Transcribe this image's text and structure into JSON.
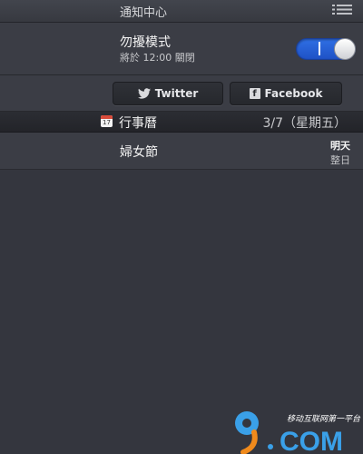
{
  "header": {
    "title": "通知中心",
    "list_icon": "list-icon"
  },
  "do_not_disturb": {
    "title": "勿擾模式",
    "subtitle": "將於 12:00 關閉",
    "enabled": true,
    "accent": "#2f6fe4"
  },
  "share": {
    "twitter_label": "Twitter",
    "twitter_icon": "twitter-bird-icon",
    "facebook_label": "Facebook",
    "facebook_icon": "facebook-f-icon"
  },
  "calendar": {
    "icon": "calendar-icon",
    "icon_number": "17",
    "title": "行事曆",
    "date": "3/7（星期五）",
    "events": [
      {
        "name": "婦女節",
        "day": "明天",
        "time": "整日"
      }
    ]
  },
  "watermark": {
    "logo_text": "9",
    "domain_text": "COM",
    "slogan": "移动互联网第一平台"
  }
}
